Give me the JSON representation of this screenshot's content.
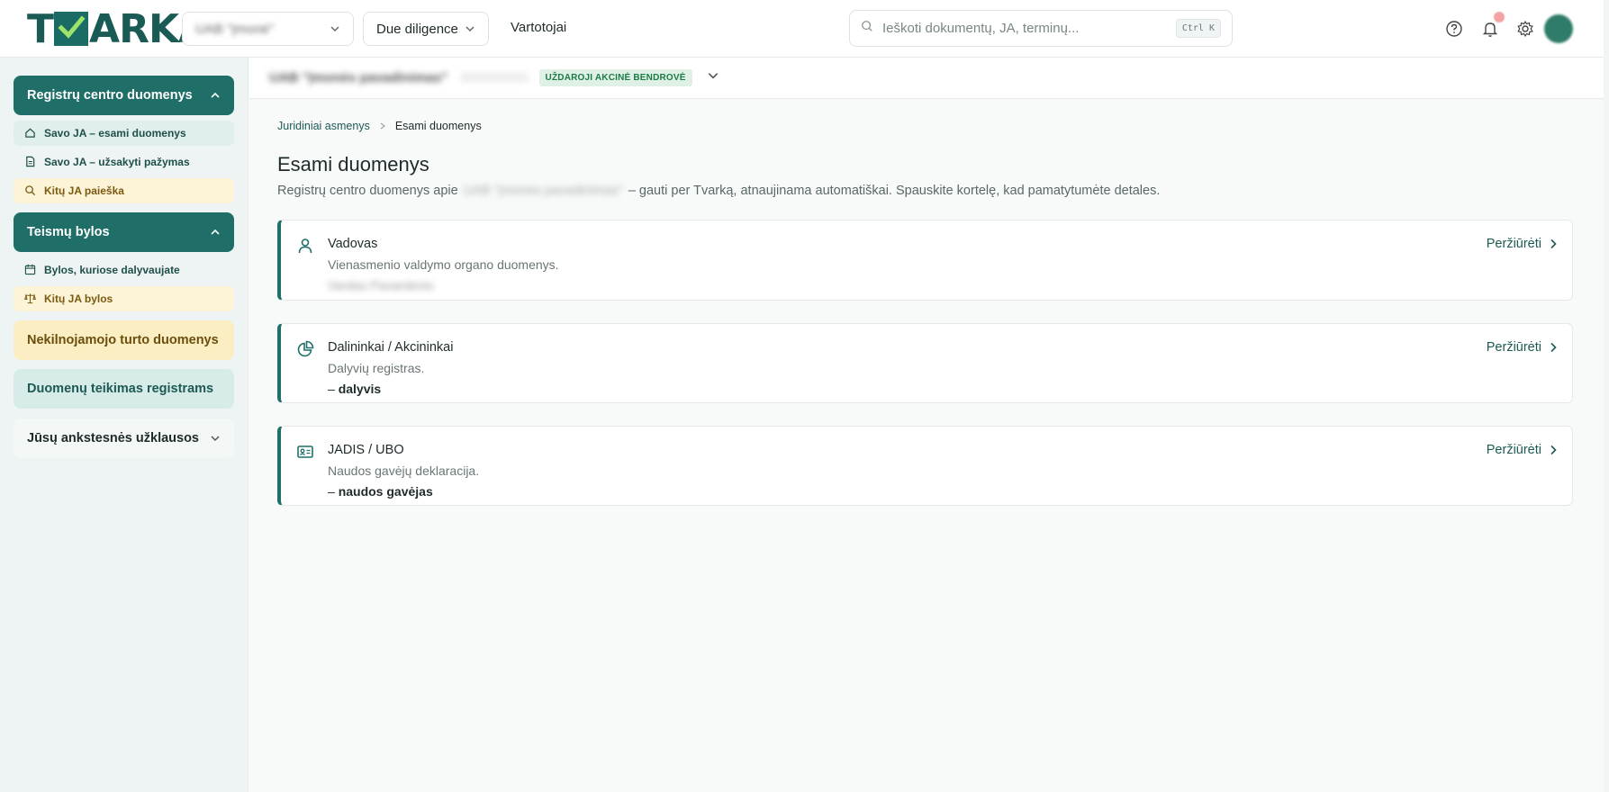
{
  "header": {
    "logo_text": "TVARKA",
    "company_select": "UAB \"Įmonė\"",
    "due_diligence": "Due diligence",
    "users_link": "Vartotojai",
    "search_placeholder": "Ieškoti dokumentų, JA, terminų...",
    "search_shortcut": "Ctrl K",
    "icons": [
      "help-icon",
      "bell-icon",
      "gear-icon",
      "avatar"
    ]
  },
  "sidebar": {
    "registry": {
      "title": "Registrų centro duomenys",
      "items": [
        {
          "label": "Savo JA – esami duomenys",
          "icon": "home-icon"
        },
        {
          "label": "Savo JA – užsakyti pažymas",
          "icon": "document-icon"
        },
        {
          "label": "Kitų JA paieška",
          "icon": "search-icon"
        }
      ]
    },
    "court": {
      "title": "Teismų bylos",
      "items": [
        {
          "label": "Bylos, kuriose dalyvaujate",
          "icon": "calendar-icon"
        },
        {
          "label": "Kitų JA bylos",
          "icon": "scale-icon"
        }
      ]
    },
    "real_estate": "Nekilnojamojo turto duomenys",
    "data_provision": "Duomenų teikimas registrams",
    "previous_queries": "Jūsų ankstesnės užklausos"
  },
  "subbar": {
    "company_name": "UAB \"Įmonės pavadinimas\"",
    "company_code": "000000000",
    "company_type": "UŽDAROJI AKCINĖ BENDROVĖ"
  },
  "breadcrumb": {
    "parent": "Juridiniai asmenys",
    "current": "Esami duomenys"
  },
  "page": {
    "title": "Esami duomenys",
    "desc_prefix": "Registrų centro duomenys apie",
    "desc_company": "UAB \"Įmonės pavadinimas\"",
    "desc_suffix": "– gauti per Tvarką, atnaujinama automatiškai. Spauskite kortelę, kad pamatytumėte detales."
  },
  "cards": [
    {
      "title": "Vadovas",
      "subtitle": "Vienasmenio valdymo organo duomenys.",
      "value": "Vardas Pavardenis",
      "action": "Peržiūrėti",
      "icon": "user-icon"
    },
    {
      "title": "Dalininkai / Akcininkai",
      "subtitle": "Dalyvių registras.",
      "value_prefix": "–",
      "value": "dalyvis",
      "action": "Peržiūrėti",
      "icon": "pie-chart-icon"
    },
    {
      "title": "JADIS / UBO",
      "subtitle": "Naudos gavėjų deklaracija.",
      "value_prefix": "–",
      "value": "naudos gavėjas",
      "action": "Peržiūrėti",
      "icon": "id-card-icon"
    }
  ],
  "colors": {
    "primary": "#1f6f68",
    "sidebar_bg": "#eef4f3",
    "yellow_bg": "#fbeec3",
    "tag_bg": "#dff1e6"
  }
}
